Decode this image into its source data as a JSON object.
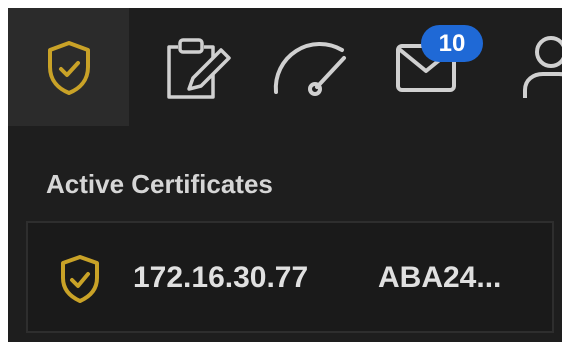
{
  "toolbar": {
    "items": [
      {
        "icon": "shield-check-icon",
        "active": true
      },
      {
        "icon": "clipboard-edit-icon",
        "active": false
      },
      {
        "icon": "gauge-icon",
        "active": false
      },
      {
        "icon": "mail-icon",
        "active": false,
        "badge": "10"
      },
      {
        "icon": "user-icon",
        "active": false
      }
    ]
  },
  "colors": {
    "accent_gold": "#c9a227",
    "icon_gray": "#d0d0d0",
    "badge_blue": "#1f69d6",
    "background": "#1e1e1e"
  },
  "certificates": {
    "title": "Active Certificates",
    "items": [
      {
        "icon": "shield-check-icon",
        "ip": "172.16.30.77",
        "id": "ABA24..."
      }
    ]
  }
}
